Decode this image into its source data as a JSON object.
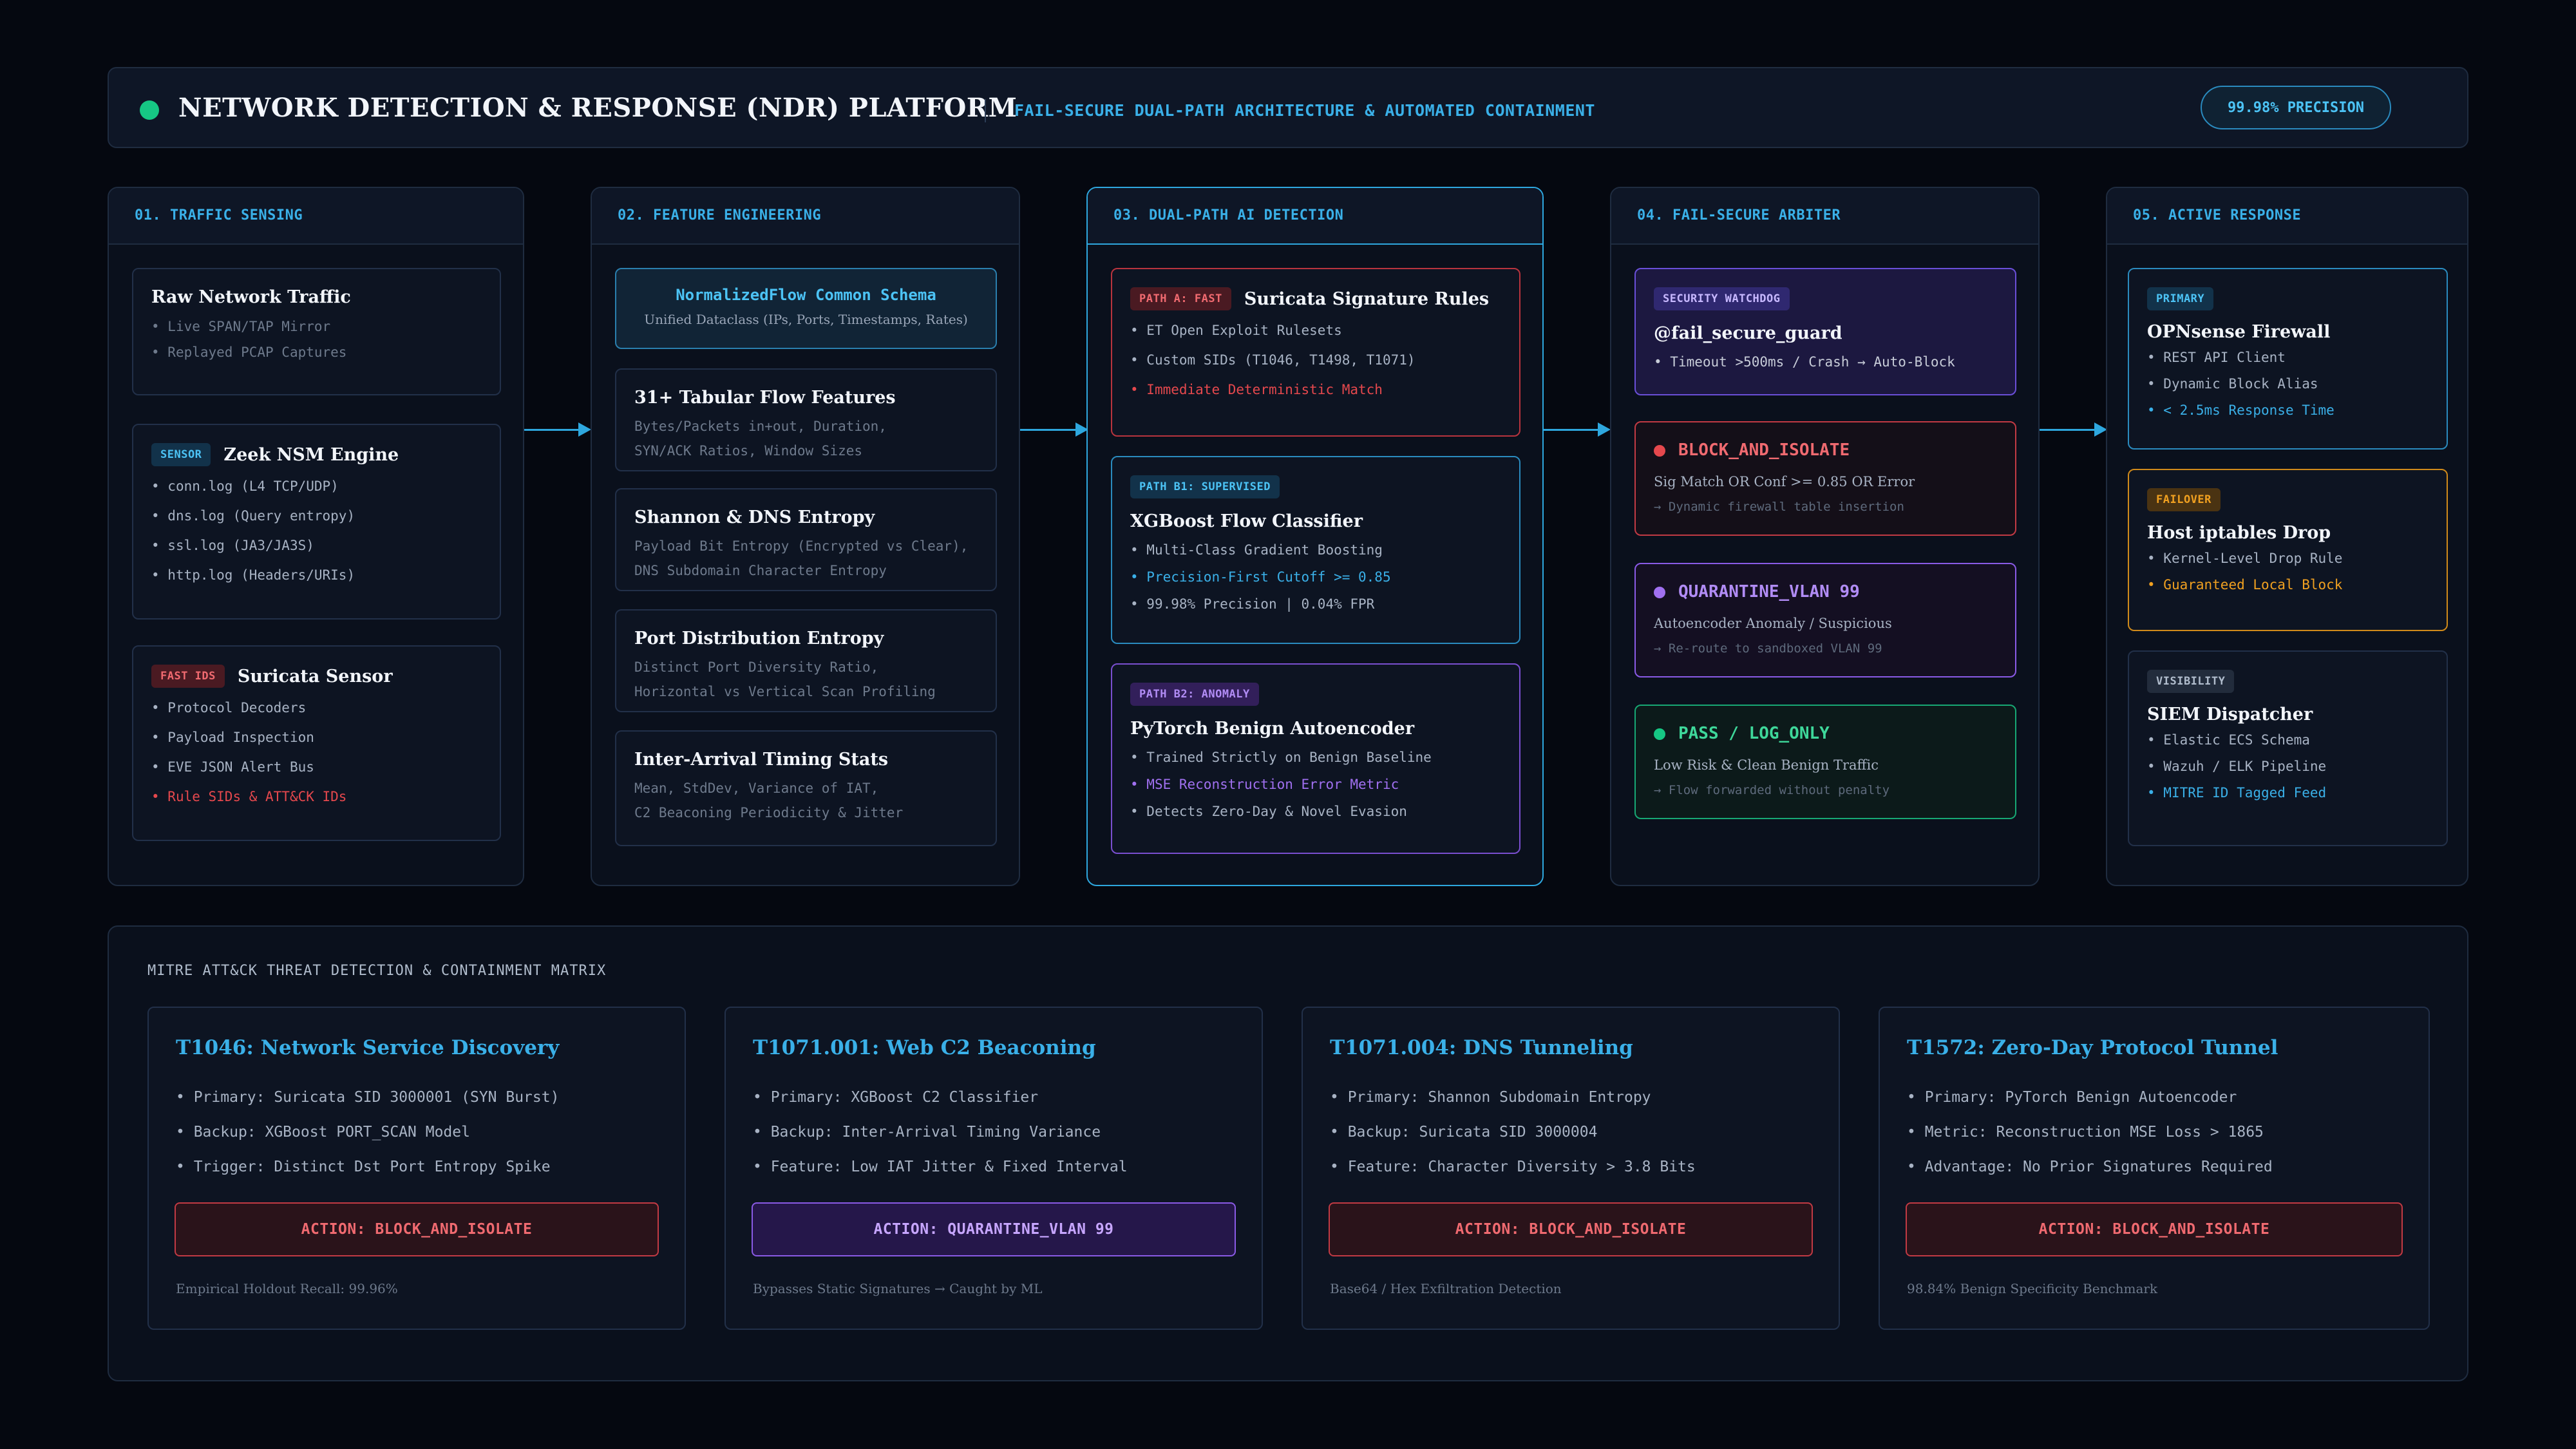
{
  "header": {
    "title": "NETWORK DETECTION & RESPONSE (NDR) PLATFORM",
    "subtitle": "FAIL-SECURE DUAL-PATH ARCHITECTURE & AUTOMATED CONTAINMENT",
    "badge": "99.98% PRECISION"
  },
  "columns": {
    "sensing": {
      "heading": "01. TRAFFIC SENSING",
      "raw": {
        "title": "Raw Network Traffic",
        "items": [
          "Live SPAN/TAP Mirror",
          "Replayed PCAP Captures"
        ]
      },
      "zeek": {
        "tag": "SENSOR",
        "title": "Zeek NSM Engine",
        "items": [
          "conn.log (L4 TCP/UDP)",
          "dns.log (Query entropy)",
          "ssl.log (JA3/JA3S)",
          "http.log (Headers/URIs)"
        ]
      },
      "suricata": {
        "tag": "FAST IDS",
        "title": "Suricata Sensor",
        "items": [
          "Protocol Decoders",
          "Payload Inspection",
          "EVE JSON Alert Bus",
          "Rule SIDs & ATT&CK IDs"
        ]
      }
    },
    "features": {
      "heading": "02. FEATURE ENGINEERING",
      "schema": {
        "title": "NormalizedFlow Common Schema",
        "sub": "Unified Dataclass (IPs, Ports, Timestamps, Rates)"
      },
      "tabular": {
        "title": "31+ Tabular Flow Features",
        "lines": [
          "Bytes/Packets in+out, Duration,",
          "SYN/ACK Ratios, Window Sizes"
        ]
      },
      "entropy": {
        "title": "Shannon & DNS Entropy",
        "lines": [
          "Payload Bit Entropy (Encrypted vs Clear),",
          "DNS Subdomain Character Entropy"
        ]
      },
      "port": {
        "title": "Port Distribution Entropy",
        "lines": [
          "Distinct Port Diversity Ratio,",
          "Horizontal vs Vertical Scan Profiling"
        ]
      },
      "timing": {
        "title": "Inter-Arrival Timing Stats",
        "lines": [
          "Mean, StdDev, Variance of IAT,",
          "C2 Beaconing Periodicity & Jitter"
        ]
      }
    },
    "detection": {
      "heading": "03. DUAL-PATH AI DETECTION",
      "pathA": {
        "tag": "PATH A: FAST",
        "title": "Suricata Signature Rules",
        "items": [
          "ET Open Exploit Rulesets",
          "Custom SIDs (T1046, T1498, T1071)",
          "Immediate Deterministic Match"
        ]
      },
      "pathB1": {
        "tag": "PATH B1: SUPERVISED",
        "title": "XGBoost Flow Classifier",
        "items": [
          "Multi-Class Gradient Boosting",
          "Precision-First Cutoff >= 0.85",
          "99.98% Precision | 0.04% FPR"
        ]
      },
      "pathB2": {
        "tag": "PATH B2: ANOMALY",
        "title": "PyTorch Benign Autoencoder",
        "items": [
          "Trained Strictly on Benign Baseline",
          "MSE Reconstruction Error Metric",
          "Detects Zero-Day & Novel Evasion"
        ]
      }
    },
    "arbiter": {
      "heading": "04. FAIL-SECURE ARBITER",
      "watchdog": {
        "tag": "SECURITY WATCHDOG",
        "title": "@fail_secure_guard",
        "items": [
          "Timeout >500ms / Crash → Auto-Block"
        ]
      },
      "block": {
        "title": "BLOCK_AND_ISOLATE",
        "desc": "Sig Match OR Conf >= 0.85 OR Error",
        "note": "→ Dynamic firewall table insertion"
      },
      "quarantine": {
        "title": "QUARANTINE_VLAN 99",
        "desc": "Autoencoder Anomaly / Suspicious",
        "note": "→ Re-route to sandboxed VLAN 99"
      },
      "pass": {
        "title": "PASS / LOG_ONLY",
        "desc": "Low Risk & Clean Benign Traffic",
        "note": "→ Flow forwarded without penalty"
      }
    },
    "response": {
      "heading": "05. ACTIVE RESPONSE",
      "opnsense": {
        "tag": "PRIMARY",
        "title": "OPNsense Firewall",
        "items": [
          "REST API Client",
          "Dynamic Block Alias",
          "< 2.5ms Response Time"
        ]
      },
      "iptables": {
        "tag": "FAILOVER",
        "title": "Host iptables Drop",
        "items": [
          "Kernel-Level Drop Rule",
          "Guaranteed Local Block"
        ]
      },
      "siem": {
        "tag": "VISIBILITY",
        "title": "SIEM Dispatcher",
        "items": [
          "Elastic ECS Schema",
          "Wazuh / ELK Pipeline",
          "MITRE ID Tagged Feed"
        ]
      }
    }
  },
  "matrix": {
    "title": "MITRE ATT&CK THREAT DETECTION & CONTAINMENT MATRIX",
    "cards": [
      {
        "title": "T1046: Network Service Discovery",
        "items": [
          "Primary: Suricata SID 3000001 (SYN Burst)",
          "Backup: XGBoost PORT_SCAN Model",
          "Trigger: Distinct Dst Port Entropy Spike"
        ],
        "action": "ACTION: BLOCK_AND_ISOLATE",
        "foot": "Empirical Holdout Recall: 99.96%"
      },
      {
        "title": "T1071.001: Web C2 Beaconing",
        "items": [
          "Primary: XGBoost C2 Classifier",
          "Backup: Inter-Arrival Timing Variance",
          "Feature: Low IAT Jitter & Fixed Interval"
        ],
        "action": "ACTION: QUARANTINE_VLAN 99",
        "foot": "Bypasses Static Signatures → Caught by ML"
      },
      {
        "title": "T1071.004: DNS Tunneling",
        "items": [
          "Primary: Shannon Subdomain Entropy",
          "Backup: Suricata SID 3000004",
          "Feature: Character Diversity > 3.8 Bits"
        ],
        "action": "ACTION: BLOCK_AND_ISOLATE",
        "foot": "Base64 / Hex Exfiltration Detection"
      },
      {
        "title": "T1572: Zero-Day Protocol Tunnel",
        "items": [
          "Primary: PyTorch Benign Autoencoder",
          "Metric: Reconstruction MSE Loss > 1865",
          "Advantage: No Prior Signatures Required"
        ],
        "action": "ACTION: BLOCK_AND_ISOLATE",
        "foot": "98.84% Benign Specificity Benchmark"
      }
    ]
  },
  "colors": {
    "accent": "#3ab0e8",
    "block": "#e5484d",
    "quarantine": "#a070f0",
    "pass": "#16c784",
    "failover": "#f0a020"
  }
}
